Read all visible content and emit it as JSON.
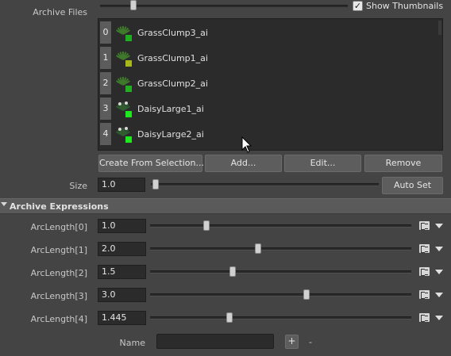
{
  "archive_files": {
    "label": "Archive Files",
    "show_thumbnails_label": "Show Thumbnails",
    "show_thumbnails_checked": true,
    "items": [
      {
        "index": "0",
        "name": "GrassClump3_ai",
        "swatch": "#1fae1f"
      },
      {
        "index": "1",
        "name": "GrassClump1_ai",
        "swatch": "#a8b81a"
      },
      {
        "index": "2",
        "name": "GrassClump2_ai",
        "swatch": "#22b022"
      },
      {
        "index": "3",
        "name": "DaisyLarge1_ai",
        "swatch": "#1ee81e"
      },
      {
        "index": "4",
        "name": "DaisyLarge2_ai",
        "swatch": "#1ee81e"
      }
    ]
  },
  "buttons": {
    "create_from_selection": "Create From Selection...",
    "add": "Add...",
    "edit": "Edit...",
    "remove": "Remove"
  },
  "size": {
    "label": "Size",
    "value": "1.0",
    "slider_fraction": 0.0,
    "auto_set": "Auto Set"
  },
  "archive_expressions": {
    "title": "Archive Expressions",
    "rows": [
      {
        "label": "ArcLength[0]",
        "value": "1.0",
        "slider_fraction": 0.21
      },
      {
        "label": "ArcLength[1]",
        "value": "2.0",
        "slider_fraction": 0.41
      },
      {
        "label": "ArcLength[2]",
        "value": "1.5",
        "slider_fraction": 0.31
      },
      {
        "label": "ArcLength[3]",
        "value": "3.0",
        "slider_fraction": 0.6
      },
      {
        "label": "ArcLength[4]",
        "value": "1.445",
        "slider_fraction": 0.3
      }
    ],
    "name_label": "Name",
    "name_value": "",
    "plus_label": "+",
    "minus_label": "-"
  },
  "colors": {
    "panel_bg": "#444444",
    "field_bg": "#2b2b2b",
    "button_bg": "#5d5d5d",
    "section_header_bg": "#5a5a5a"
  },
  "icons": [
    "checkbox-check-icon",
    "plant-thumbnail-icon",
    "expression-editor-icon",
    "dropdown-arrow-icon",
    "collapse-arrow-icon",
    "mouse-cursor-icon"
  ]
}
